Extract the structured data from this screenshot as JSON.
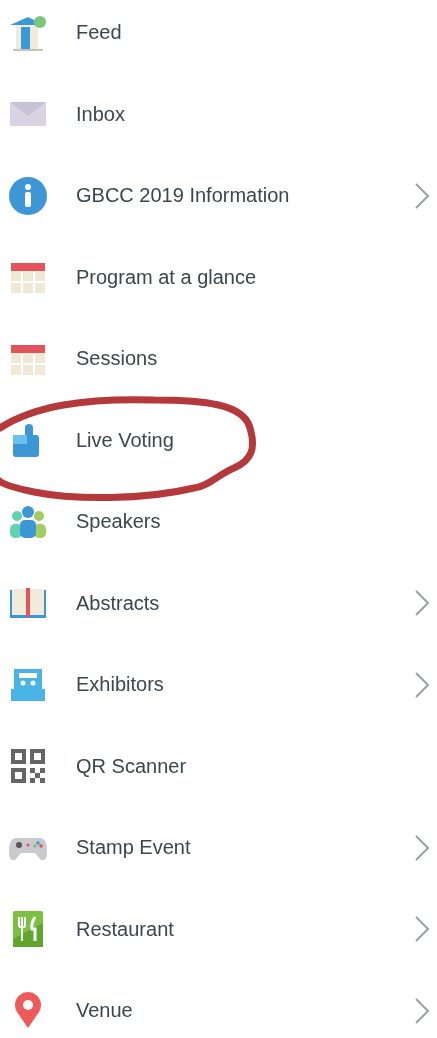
{
  "menu": {
    "items": [
      {
        "label": "Feed",
        "expandable": false,
        "circled": false
      },
      {
        "label": "Inbox",
        "expandable": false,
        "circled": false
      },
      {
        "label": "GBCC 2019 Information",
        "expandable": true,
        "circled": false
      },
      {
        "label": "Program at a glance",
        "expandable": false,
        "circled": false
      },
      {
        "label": "Sessions",
        "expandable": false,
        "circled": false
      },
      {
        "label": "Live Voting",
        "expandable": false,
        "circled": true
      },
      {
        "label": "Speakers",
        "expandable": false,
        "circled": false
      },
      {
        "label": "Abstracts",
        "expandable": true,
        "circled": false
      },
      {
        "label": "Exhibitors",
        "expandable": true,
        "circled": false
      },
      {
        "label": "QR Scanner",
        "expandable": false,
        "circled": false
      },
      {
        "label": "Stamp Event",
        "expandable": true,
        "circled": false
      },
      {
        "label": "Restaurant",
        "expandable": true,
        "circled": false
      },
      {
        "label": "Venue",
        "expandable": true,
        "circled": false
      }
    ]
  }
}
